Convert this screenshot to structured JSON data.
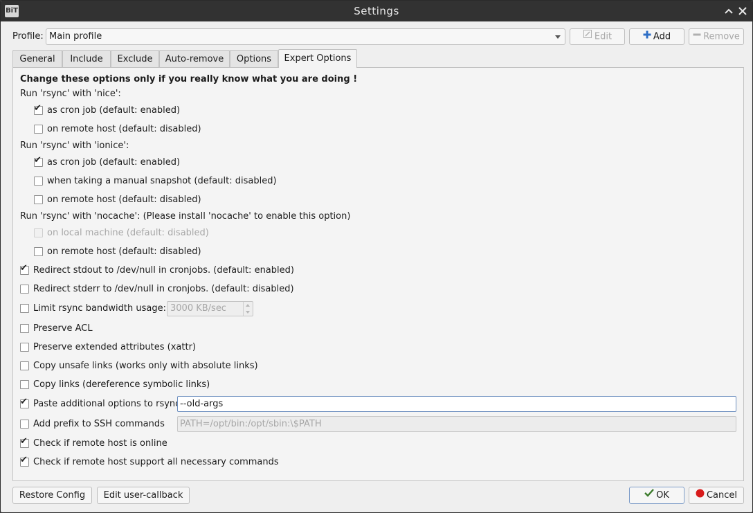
{
  "window": {
    "title": "Settings"
  },
  "profile": {
    "label": "Profile:",
    "selected": "Main profile"
  },
  "profile_buttons": {
    "edit": "Edit",
    "add": "Add",
    "remove": "Remove"
  },
  "tabs": [
    "General",
    "Include",
    "Exclude",
    "Auto-remove",
    "Options",
    "Expert Options"
  ],
  "expert": {
    "warning": "Change these options only if you really know what you are doing !",
    "nice": {
      "label": "Run 'rsync' with 'nice':",
      "cron": {
        "label": "as cron job (default: enabled)",
        "checked": true
      },
      "remote": {
        "label": "on remote host (default: disabled)",
        "checked": false
      }
    },
    "ionice": {
      "label": "Run 'rsync' with 'ionice':",
      "cron": {
        "label": "as cron job (default: enabled)",
        "checked": true
      },
      "manual": {
        "label": "when taking a manual snapshot (default: disabled)",
        "checked": false
      },
      "remote": {
        "label": "on remote host (default: disabled)",
        "checked": false
      }
    },
    "nocache": {
      "label": "Run 'rsync' with 'nocache': (Please install 'nocache' to enable this option)",
      "local": {
        "label": "on local machine (default: disabled)",
        "checked": false,
        "disabled": true
      },
      "remote": {
        "label": "on remote host (default: disabled)",
        "checked": false
      }
    },
    "redirect_stdout": {
      "label": "Redirect stdout to /dev/null in cronjobs. (default: enabled)",
      "checked": true
    },
    "redirect_stderr": {
      "label": "Redirect stderr to /dev/null in cronjobs. (default: disabled)",
      "checked": false
    },
    "bwlimit": {
      "label": "Limit rsync bandwidth usage:",
      "checked": false,
      "value": "3000 KB/sec"
    },
    "acl": {
      "label": "Preserve ACL",
      "checked": false
    },
    "xattr": {
      "label": "Preserve extended attributes (xattr)",
      "checked": false
    },
    "unsafe_links": {
      "label": "Copy unsafe links (works only with absolute links)",
      "checked": false
    },
    "copy_links": {
      "label": "Copy links (dereference symbolic links)",
      "checked": false
    },
    "rsync_options": {
      "label": "Paste additional options to rsync",
      "checked": true,
      "value": "--old-args"
    },
    "ssh_prefix": {
      "label": "Add prefix to SSH commands",
      "checked": false,
      "placeholder": "PATH=/opt/bin:/opt/sbin:\\$PATH"
    },
    "check_online": {
      "label": "Check if remote host is online",
      "checked": true
    },
    "check_commands": {
      "label": "Check if remote host support all necessary commands",
      "checked": true
    }
  },
  "footer": {
    "restore": "Restore Config",
    "user_callback": "Edit user-callback",
    "ok": "OK",
    "cancel": "Cancel"
  },
  "colors": {
    "titlebar": "#323232",
    "window": "#efefef",
    "add_icon": "#2f6fc6",
    "cancel_icon": "#d81b1b",
    "ok_icon": "#3a7a2a"
  }
}
